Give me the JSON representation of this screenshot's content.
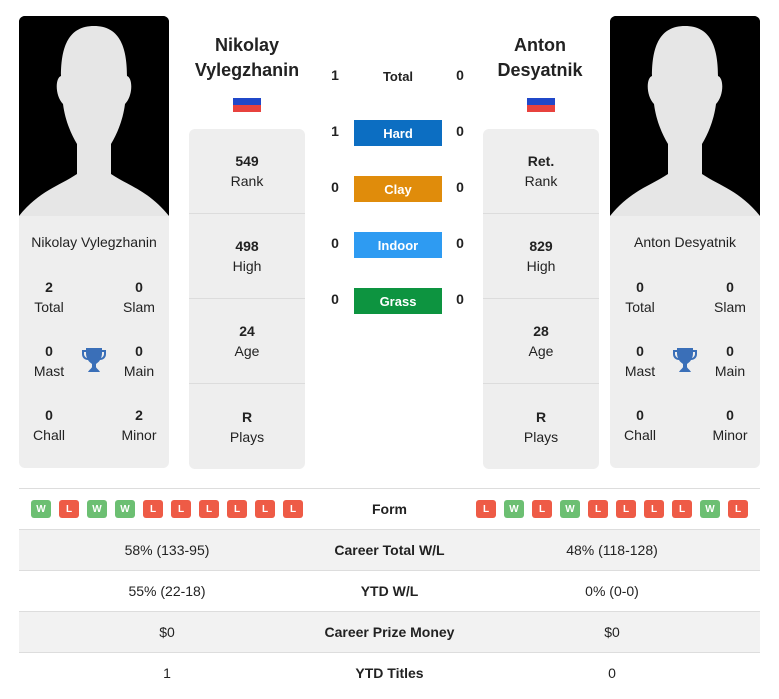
{
  "colors": {
    "hard": "#0c6ec2",
    "clay": "#e08c0b",
    "indoor": "#2e9bf2",
    "grass": "#0d9440",
    "win": "#6cbf72",
    "loss": "#ee5b46",
    "trophy": "#3a6fb8"
  },
  "player1": {
    "name_line1": "Nikolay",
    "name_line2": "Vylegzhanin",
    "full_name": "Nikolay Vylegzhanin",
    "flag": "russia-flag",
    "rank": "549",
    "rank_label": "Rank",
    "high": "498",
    "high_label": "High",
    "age": "24",
    "age_label": "Age",
    "plays": "R",
    "plays_label": "Plays",
    "titles": {
      "total": "2",
      "total_label": "Total",
      "slam": "0",
      "slam_label": "Slam",
      "mast": "0",
      "mast_label": "Mast",
      "main": "0",
      "main_label": "Main",
      "chall": "0",
      "chall_label": "Chall",
      "minor": "2",
      "minor_label": "Minor"
    },
    "form": [
      "W",
      "L",
      "W",
      "W",
      "L",
      "L",
      "L",
      "L",
      "L",
      "L"
    ]
  },
  "player2": {
    "name_line1": "Anton",
    "name_line2": "Desyatnik",
    "full_name": "Anton Desyatnik",
    "flag": "russia-flag",
    "rank": "Ret.",
    "rank_label": "Rank",
    "high": "829",
    "high_label": "High",
    "age": "28",
    "age_label": "Age",
    "plays": "R",
    "plays_label": "Plays",
    "titles": {
      "total": "0",
      "total_label": "Total",
      "slam": "0",
      "slam_label": "Slam",
      "mast": "0",
      "mast_label": "Mast",
      "main": "0",
      "main_label": "Main",
      "chall": "0",
      "chall_label": "Chall",
      "minor": "0",
      "minor_label": "Minor"
    },
    "form": [
      "L",
      "W",
      "L",
      "W",
      "L",
      "L",
      "L",
      "L",
      "W",
      "L"
    ]
  },
  "h2h": {
    "total": {
      "label": "Total",
      "p1": "1",
      "p2": "0"
    },
    "hard": {
      "label": "Hard",
      "p1": "1",
      "p2": "0"
    },
    "clay": {
      "label": "Clay",
      "p1": "0",
      "p2": "0"
    },
    "indoor": {
      "label": "Indoor",
      "p1": "0",
      "p2": "0"
    },
    "grass": {
      "label": "Grass",
      "p1": "0",
      "p2": "0"
    }
  },
  "table": {
    "form_label": "Form",
    "rows": [
      {
        "label": "Career Total W/L",
        "p1": "58% (133-95)",
        "p2": "48% (118-128)"
      },
      {
        "label": "YTD W/L",
        "p1": "55% (22-18)",
        "p2": "0% (0-0)"
      },
      {
        "label": "Career Prize Money",
        "p1": "$0",
        "p2": "$0"
      },
      {
        "label": "YTD Titles",
        "p1": "1",
        "p2": "0"
      }
    ]
  }
}
